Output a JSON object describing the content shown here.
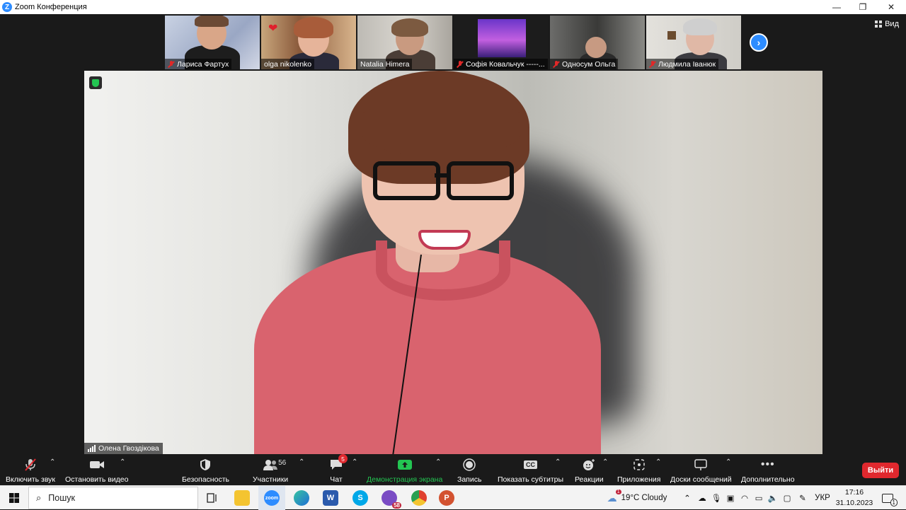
{
  "window": {
    "app_icon": "Z",
    "title": "Zoom Конференция",
    "controls": [
      "—",
      "❐",
      "✕"
    ]
  },
  "view_button": {
    "label": "Вид"
  },
  "thumbnails": [
    {
      "name": "Лариса Фартух",
      "muted": true
    },
    {
      "name": "olga nikolenko",
      "muted": false
    },
    {
      "name": "Natalia Himera",
      "muted": false
    },
    {
      "name": "Софія Ковальчук -----...",
      "muted": true
    },
    {
      "name": "Односум Ольга",
      "muted": true
    },
    {
      "name": "Людмила Іванюк",
      "muted": true
    }
  ],
  "main_speaker": {
    "name": "Олена Гвоздікова"
  },
  "toolbar": {
    "mute_label": "Включить звук",
    "video_label": "Остановить видео",
    "security_label": "Безопасность",
    "participants_label": "Участники",
    "participants_count": "56",
    "chat_label": "Чат",
    "chat_badge": "5",
    "share_label": "Демонстрация экрана",
    "record_label": "Запись",
    "captions_label": "Показать субтитры",
    "captions_icon": "CC",
    "reactions_label": "Реакции",
    "apps_label": "Приложения",
    "whiteboards_label": "Доски сообщений",
    "more_label": "Дополнительно",
    "leave_label": "Выйти"
  },
  "taskbar": {
    "search_placeholder": "Пошук",
    "viber_badge": "58",
    "weather": "19°C  Cloudy",
    "weather_badge": "1",
    "language": "УКР",
    "time": "17:16",
    "date": "31.10.2023",
    "notif_badge": "1"
  },
  "colors": {
    "zoom_blue": "#2d8cff",
    "leave_red": "#e0282e",
    "share_green": "#23c552"
  }
}
